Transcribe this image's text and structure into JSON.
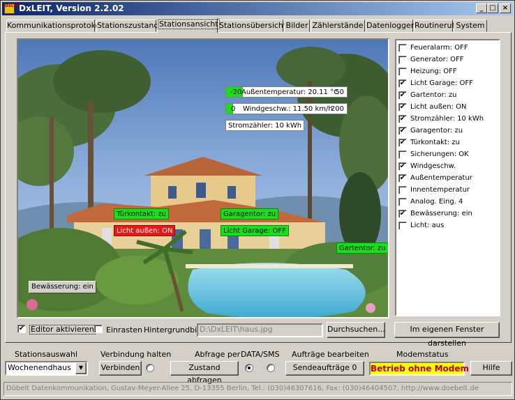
{
  "window": {
    "title": "DxLEIT, Version 2.2.02",
    "icon_text": "DxLEIT"
  },
  "titlebar_buttons": {
    "minimize": "_",
    "maximize": "□",
    "close": "×"
  },
  "tabs": [
    {
      "label": "Kommunikationsprotokoll"
    },
    {
      "label": "Stationszustand"
    },
    {
      "label": "Stationsansicht"
    },
    {
      "label": "Stationsübersicht"
    },
    {
      "label": "Bilder"
    },
    {
      "label": "Zählerstände"
    },
    {
      "label": "Datenlogger"
    },
    {
      "label": "Routineruf"
    },
    {
      "label": "System"
    }
  ],
  "active_tab": "Stationsansicht",
  "scene": {
    "overlays": {
      "aussentemp": {
        "min": "-20",
        "label": "Außentemperatur: 20.11 °C",
        "max": "50",
        "level": 0.58
      },
      "wind": {
        "min": "0",
        "label": "Windgeschw.: 11.50 km/h",
        "max": "200",
        "level": 0.06
      },
      "strom": "Stromzähler: 10 kWh",
      "tuer": "Türkontakt: zu",
      "licht_aussen": "Licht außen: ON",
      "garagentor": "Garagentor: zu",
      "licht_garage": "Licht Garage: OFF",
      "gartentor": "Gartentor: zu",
      "bewaesserung": "Bewässerung: ein"
    },
    "colors": {
      "on_green": "#18e018",
      "alarm_red": "#e81818",
      "sky": "#6a93c9"
    }
  },
  "sensor_list": [
    {
      "label": "Feueralarm: OFF",
      "checked": false
    },
    {
      "label": "Generator: OFF",
      "checked": false
    },
    {
      "label": "Heizung: OFF",
      "checked": false
    },
    {
      "label": "Licht Garage: OFF",
      "checked": true
    },
    {
      "label": "Gartentor: zu",
      "checked": true
    },
    {
      "label": "Licht außen: ON",
      "checked": true
    },
    {
      "label": "Stromzähler: 10 kWh",
      "checked": true
    },
    {
      "label": "Garagentor: zu",
      "checked": true
    },
    {
      "label": "Türkontakt: zu",
      "checked": true
    },
    {
      "label": "Sicherungen: OK",
      "checked": false
    },
    {
      "label": "Windgeschw.",
      "checked": true
    },
    {
      "label": "Außentemperatur",
      "checked": true
    },
    {
      "label": "Innentemperatur",
      "checked": false
    },
    {
      "label": "Analog. Eing. 4",
      "checked": false
    },
    {
      "label": "Bewässerung: ein",
      "checked": true
    },
    {
      "label": "Licht: aus",
      "checked": false
    }
  ],
  "editor": {
    "editor_label": "Editor aktivieren",
    "editor_checked": true,
    "snap_label": "Einrasten",
    "snap_checked": false,
    "bg_label": "Hintergrundbild:",
    "bg_value": "D:\\DxLEIT\\haus.jpg",
    "browse_button": "Durchsuchen...",
    "own_window_button": "Im eigenen Fenster darstellen"
  },
  "bottom": {
    "station_label": "Stationsauswahl",
    "station_value": "Wochenendhaus",
    "connection_label": "Verbindung  halten",
    "connect_button": "Verbinden",
    "query_label": "Abfrage per",
    "query_method_label": "DATA/SMS",
    "query_button": "Zustand abfragen",
    "jobs_label": "Aufträge bearbeiten",
    "send_button": "Sendeaufträge 0",
    "modem_label": "Modemstatus",
    "modem_status": "Betrieb ohne Modem",
    "help_button": "Hilfe"
  },
  "status_bar": "Döbelt Datenkommunikation, Gustav-Meyer-Allee 25, D-13355 Berlin, Tel.: (030)46307616, Fax: (030)46404507, http://www.doebelt.de"
}
